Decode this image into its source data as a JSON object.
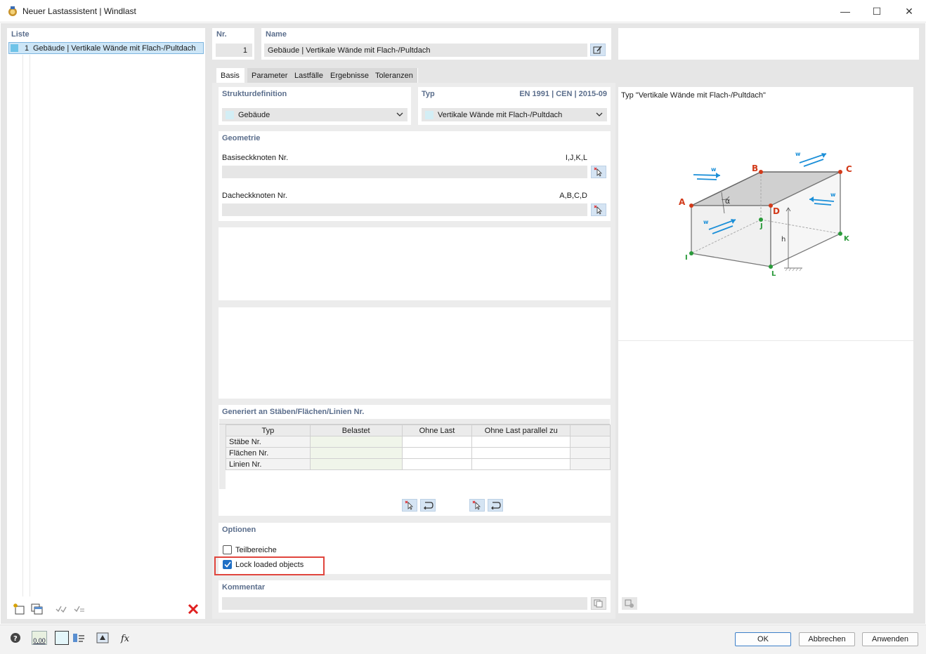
{
  "window": {
    "title": "Neuer Lastassistent | Windlast",
    "minimize_glyph": "—",
    "maximize_glyph": "☐",
    "close_glyph": "✕"
  },
  "list_panel": {
    "header": "Liste",
    "items": [
      {
        "number": "1",
        "label": "Gebäude | Vertikale Wände mit Flach-/Pultdach"
      }
    ]
  },
  "nr": {
    "header": "Nr.",
    "value": "1"
  },
  "name": {
    "header": "Name",
    "value": "Gebäude | Vertikale Wände mit Flach-/Pultdach"
  },
  "tabs": [
    "Basis",
    "Parameter",
    "Lastfälle",
    "Ergebnisse",
    "Toleranzen"
  ],
  "active_tab": "Basis",
  "structure": {
    "header": "Strukturdefinition",
    "value": "Gebäude"
  },
  "type_section": {
    "header": "Typ",
    "norm": "EN 1991 | CEN | 2015-09",
    "value": "Vertikale Wände mit Flach-/Pultdach"
  },
  "geometry": {
    "header": "Geometrie",
    "base_nodes_label": "Basiseckknoten Nr.",
    "base_nodes_hint": "I,J,K,L",
    "base_nodes_value": "",
    "roof_nodes_label": "Dacheckknoten Nr.",
    "roof_nodes_hint": "A,B,C,D",
    "roof_nodes_value": ""
  },
  "generated": {
    "header": "Generiert an Stäben/Flächen/Linien Nr.",
    "columns": [
      "Typ",
      "Belastet",
      "Ohne Last",
      "Ohne Last parallel zu"
    ],
    "rows": [
      {
        "type": "Stäbe Nr.",
        "loaded": "",
        "no_load": "",
        "parallel": ""
      },
      {
        "type": "Flächen Nr.",
        "loaded": "",
        "no_load": "",
        "parallel": ""
      },
      {
        "type": "Linien Nr.",
        "loaded": "",
        "no_load": "",
        "parallel": ""
      }
    ]
  },
  "options": {
    "header": "Optionen",
    "teilbereiche_label": "Teilbereiche",
    "teilbereiche_checked": false,
    "lock_label": "Lock loaded objects",
    "lock_checked": true
  },
  "comment": {
    "header": "Kommentar",
    "value": ""
  },
  "preview": {
    "caption": "Typ \"Vertikale Wände mit Flach-/Pultdach\"",
    "labels": {
      "A": "A",
      "B": "B",
      "C": "C",
      "D": "D",
      "I": "I",
      "J": "J",
      "K": "K",
      "L": "L",
      "w": "w",
      "h": "h",
      "alpha": "α"
    }
  },
  "footer": {
    "ok": "OK",
    "cancel": "Abbrechen",
    "apply": "Anwenden",
    "decimal_icon_text": "0,00"
  },
  "colors": {
    "roof_node": "#d23a1a",
    "base_node": "#2a9a3a",
    "wind_arrow": "#1b8fd8",
    "header_text": "#5b6e8c",
    "highlight": "#e0453d"
  }
}
